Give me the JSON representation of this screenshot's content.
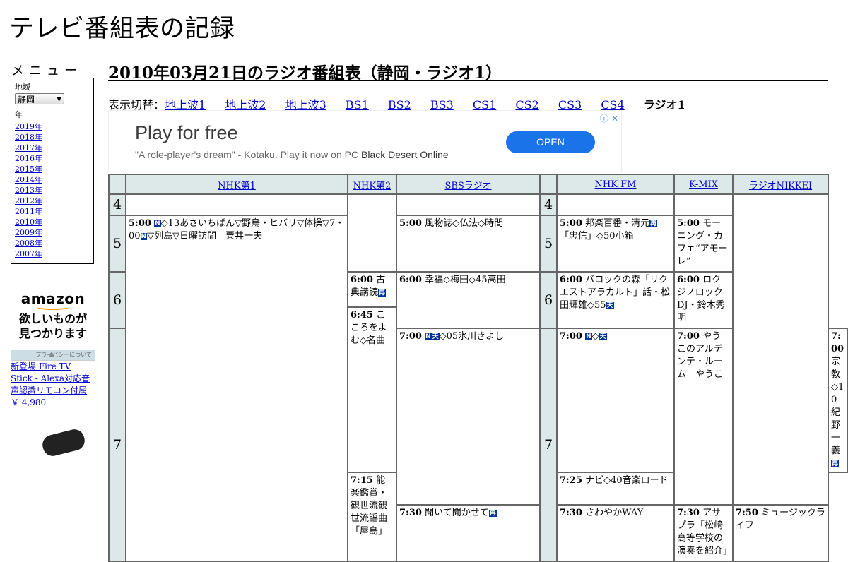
{
  "site": {
    "title": "テレビ番組表の記録"
  },
  "menu": {
    "heading": "メニュー",
    "region_label": "地域",
    "region_value": "静岡",
    "year_label": "年",
    "years": [
      "2019年",
      "2018年",
      "2017年",
      "2016年",
      "2015年",
      "2014年",
      "2013年",
      "2012年",
      "2011年",
      "2010年",
      "2009年",
      "2008年",
      "2007年"
    ]
  },
  "amazon": {
    "logo": "amazon",
    "tagline_1": "欲しいものが",
    "tagline_2": "見つかります",
    "privacy": "プライバシーについて",
    "product": "新登場 Fire TV Stick - Alexa対応音声認識リモコン付属",
    "price": "￥ 4,980"
  },
  "page": {
    "heading": "2010年03月21日のラジオ番組表（静岡・ラジオ1）"
  },
  "switcher": {
    "prefix": "表示切替：",
    "links": [
      "地上波1",
      "地上波2",
      "地上波3",
      "BS1",
      "BS2",
      "BS3",
      "CS1",
      "CS2",
      "CS3",
      "CS4"
    ],
    "current": "ラジオ1"
  },
  "ad": {
    "title": "Play for free",
    "quote": "\"A role-player's dream\" - Kotaku. Play it now on PC",
    "game": "Black Desert Online",
    "button": "OPEN",
    "info_icon": "ⓘ",
    "close_icon": "✕"
  },
  "grid": {
    "channels": [
      "NHK第1",
      "NHK第2",
      "SBSラジオ",
      "NHK FM",
      "K-MIX",
      "ラジオNIKKEI"
    ],
    "hours": [
      "4",
      "5",
      "6",
      "7"
    ],
    "programs": {
      "nhk1_500": {
        "time": "5:00",
        "text": "◇13あさいちばん▽野鳥・ヒバリ▽体操▽7・00",
        "text2": "▽列島▽日曜訪問　粟井一夫"
      },
      "nhk2_600": {
        "time": "6:00",
        "text": "古典講読"
      },
      "nhk2_645": {
        "time": "6:45",
        "text": "こころをよむ◇名曲"
      },
      "nhk2_730": {
        "time": "7:30",
        "text": "聞いて聞かせて"
      },
      "sbs_500": {
        "time": "5:00",
        "text": "風物誌◇仏法◇時間"
      },
      "sbs_600": {
        "time": "6:00",
        "text": "幸福◇梅田◇45高田"
      },
      "sbs_700": {
        "time": "7:00",
        "text": "◇05氷川きよし"
      },
      "sbs_730": {
        "time": "7:30",
        "text": "さわやかWAY"
      },
      "fm_500": {
        "time": "5:00",
        "text": "邦楽百番・清元",
        "text2": "「忠信」◇50小箱"
      },
      "fm_600": {
        "time": "6:00",
        "text": "バロックの森「リクエストアラカルト」話・松田輝雄◇55"
      },
      "fm_700": {
        "time": "7:00",
        "text": "◇"
      },
      "fm_715": {
        "time": "7:15",
        "text": "能楽鑑賞・観世流観世流謡曲「屋島」"
      },
      "kmix_500": {
        "time": "5:00",
        "text": "モーニング・カフェ“アモーレ”"
      },
      "kmix_600": {
        "time": "6:00",
        "text": "ロクジノロック　DJ・鈴木秀明"
      },
      "kmix_700": {
        "time": "7:00",
        "text": "やうこのアルデンテ・ルーム　やうこ"
      },
      "kmix_730": {
        "time": "7:30",
        "text": "アサプラ「松崎高等学校の演奏を紹介」"
      },
      "nikkei_700": {
        "time": "7:00",
        "text": "宗教◇10紀野一義"
      },
      "nikkei_725": {
        "time": "7:25",
        "text": "ナビ◇40音楽ロード"
      },
      "nikkei_750": {
        "time": "7:50",
        "text": "ミュージックライフ"
      }
    },
    "badges": {
      "news": "N",
      "weather": "天",
      "rerun": "再"
    }
  }
}
